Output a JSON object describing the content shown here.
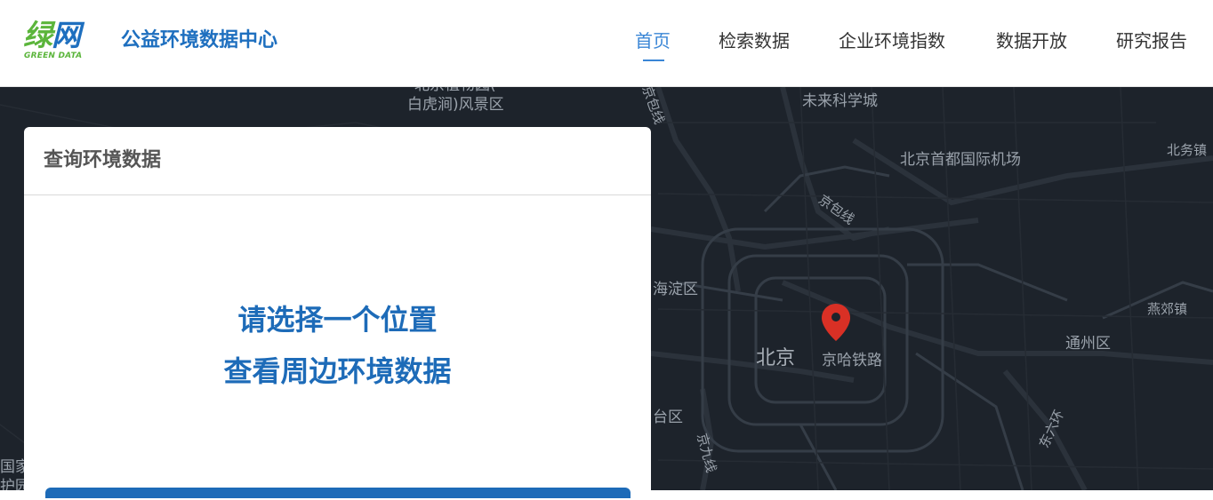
{
  "header": {
    "logo_cn_green": "绿",
    "logo_cn_blue": "网",
    "logo_en": "GREEN DATA",
    "site_title": "公益环境数据中心",
    "nav": [
      {
        "label": "首页",
        "active": true
      },
      {
        "label": "检索数据",
        "active": false
      },
      {
        "label": "企业环境指数",
        "active": false
      },
      {
        "label": "数据开放",
        "active": false
      },
      {
        "label": "研究报告",
        "active": false
      }
    ]
  },
  "panel": {
    "title": "查询环境数据",
    "prompt_line1": "请选择一个位置",
    "prompt_line2": "查看周边环境数据"
  },
  "map": {
    "labels": {
      "l1": "北京植物园(",
      "l2": "白虎涧)风景区",
      "l3": "京包线",
      "l4": "未来科学城",
      "l5": "北京首都国际机场",
      "l6": "北务镇",
      "l7": "京包线",
      "l8": "海淀区",
      "l9": "燕郊镇",
      "l10": "北京",
      "l11": "京哈铁路",
      "l12": "通州区",
      "l13": "台区",
      "l14": "京九线",
      "l15": "东六环",
      "l16": "国家",
      "l17": "护园"
    },
    "pin_color": "#d93025"
  }
}
